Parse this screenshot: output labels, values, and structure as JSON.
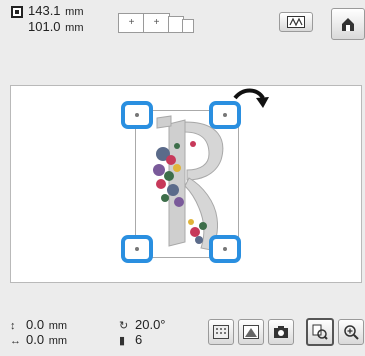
{
  "header": {
    "width_value": "143.1",
    "height_value": "101.0",
    "unit": "mm",
    "hoop_labels": [
      "+",
      "+"
    ]
  },
  "footer": {
    "move_v": "0.0",
    "move_h": "0.0",
    "unit": "mm",
    "rotation": "20.0°",
    "density": "6"
  },
  "icons": {
    "size": "embroidery-size-icon",
    "hoops": "hoop-size-selector",
    "image_button": "image-icon",
    "home_button": "home-icon",
    "rotate": "rotate-arrow-icon",
    "bottom_buttons": [
      "background-pattern-icon",
      "thread-color-icon",
      "camera-icon",
      "preview-icon",
      "zoom-icon"
    ]
  },
  "colors": {
    "handle": "#2a8fe0",
    "canvas": "#ffffff",
    "background": "#ececec"
  }
}
